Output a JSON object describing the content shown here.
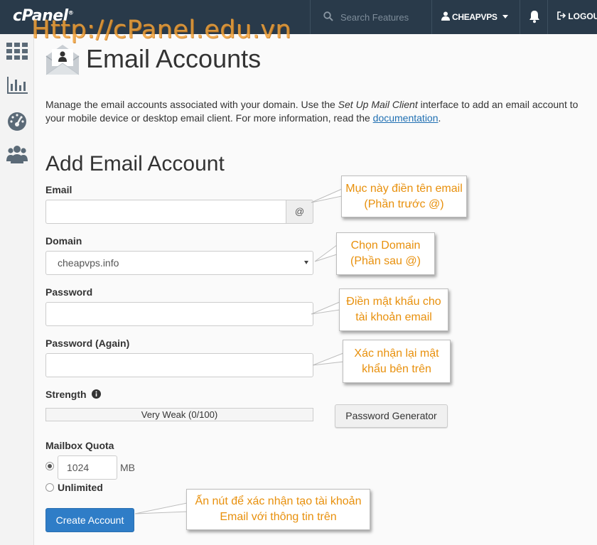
{
  "topbar": {
    "logo": "cPanel",
    "search_placeholder": "Search Features",
    "username": "CHEAPVPS",
    "logout_label": "LOGOUT"
  },
  "watermark": "Http://cPanel.edu.vn",
  "sidebar": {
    "items": [
      {
        "icon": "apps-grid-icon"
      },
      {
        "icon": "stats-chart-icon"
      },
      {
        "icon": "dashboard-gauge-icon"
      },
      {
        "icon": "users-icon"
      }
    ]
  },
  "page": {
    "title": "Email Accounts",
    "intro_part1": "Manage the email accounts associated with your domain. Use the ",
    "intro_emph": "Set Up Mail Client",
    "intro_part2": " interface to add an email account to",
    "intro_line2": "your mobile device or desktop email client. For more information, read the ",
    "intro_link": "documentation",
    "intro_end": "."
  },
  "form": {
    "section_title": "Add Email Account",
    "email_label": "Email",
    "email_value": "",
    "at_sign": "@",
    "domain_label": "Domain",
    "domain_value": "cheapvps.info",
    "password_label": "Password",
    "password_again_label": "Password (Again)",
    "strength_label": "Strength",
    "strength_value": "Very Weak (0/100)",
    "strength_score": 0,
    "password_generator_label": "Password Generator",
    "quota_label": "Mailbox Quota",
    "quota_value": "1024",
    "quota_unit": "MB",
    "quota_selected": "limited",
    "unlimited_label": "Unlimited",
    "create_button_label": "Create Account"
  },
  "callouts": {
    "email": "Mục này điền tên email (Phần trước @)",
    "domain": "Chọn Domain (Phần sau @)",
    "password": "Điền mật khẩu cho tài khoản email",
    "password_again": "Xác nhận lại mật khẩu bên trên",
    "create": "Ấn nút để xác nhận tạo tài khoản Email với thông tin trên"
  },
  "colors": {
    "topbar": "#293a4a",
    "primary_button": "#2f7dc7",
    "link": "#1f6fb2",
    "callout_text": "#e8900c",
    "watermark": "#f2a33a"
  }
}
